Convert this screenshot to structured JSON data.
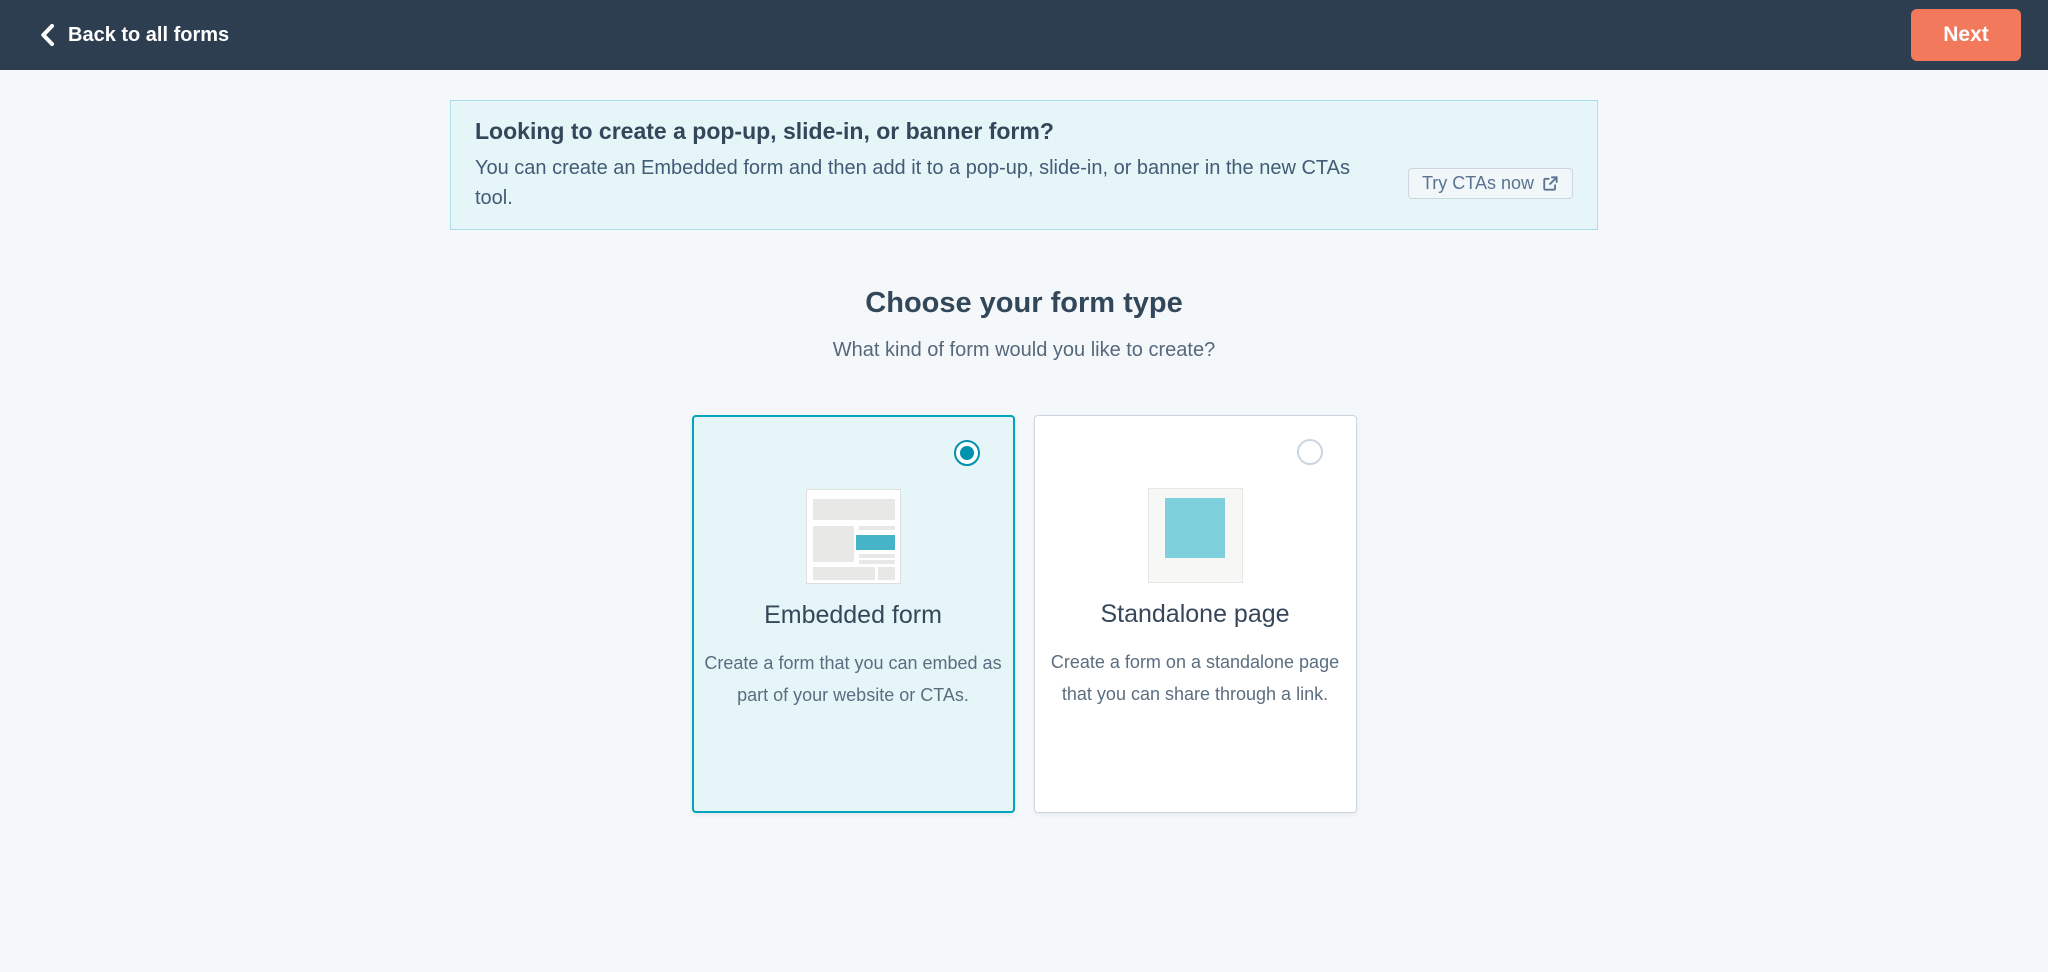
{
  "topbar": {
    "back_label": "Back to all forms",
    "next_label": "Next"
  },
  "banner": {
    "title": "Looking to create a pop-up, slide-in, or banner form?",
    "body": "You can create an Embedded form and then add it to a pop-up, slide-in, or banner in the new CTAs tool.",
    "cta_label": "Try CTAs now"
  },
  "main": {
    "title": "Choose your form type",
    "subtitle": "What kind of form would you like to create?",
    "options": [
      {
        "id": "embedded-form",
        "label": "Embedded form",
        "description": "Create a form that you can embed as part of your website or CTAs.",
        "selected": true
      },
      {
        "id": "standalone-page",
        "label": "Standalone page",
        "description": "Create a form on a standalone page that you can share through a link.",
        "selected": false
      }
    ]
  },
  "icons": {
    "back": "chevron-left-icon",
    "cta_external": "external-link-icon",
    "embedded_preview": "embedded-form-icon",
    "standalone_preview": "standalone-page-icon"
  },
  "colors": {
    "page_bg": "#f5f8fa",
    "topbar_bg": "#2d3e50",
    "accent_orange": "#f2795c",
    "accent_teal": "#00a4bd",
    "radio_teal": "#0091ae",
    "banner_bg": "#e5f5f8",
    "banner_border": "#a9dfeb",
    "selected_card_bg": "#e5f5f8",
    "icon_teal_bar": "#46b4c7",
    "icon_teal_square": "#7ed0dc"
  }
}
